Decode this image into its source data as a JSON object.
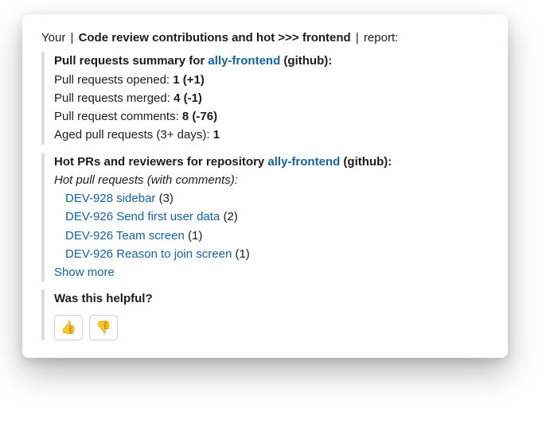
{
  "header": {
    "prefix": "Your",
    "sep": "|",
    "title": "Code review contributions and hot >>> frontend",
    "suffix": "report:"
  },
  "summary": {
    "heading_prefix": "Pull requests summary for ",
    "repo_link": "ally-frontend",
    "heading_suffix": " (github):",
    "opened_label": "Pull requests opened: ",
    "opened_value": "1 (+1)",
    "merged_label": "Pull requests merged: ",
    "merged_value": "4 (-1)",
    "comments_label": "Pull request comments: ",
    "comments_value": "8 (-76)",
    "aged_label": "Aged pull requests (3+ days): ",
    "aged_value": "1"
  },
  "hot": {
    "heading_prefix": "Hot PRs and reviewers for repository ",
    "repo_link": "ally-frontend",
    "heading_suffix": " (github):",
    "subheading": "Hot pull requests (with comments):",
    "items": [
      {
        "title": "DEV-928 sidebar",
        "count": "(3)"
      },
      {
        "title": "DEV-926 Send first user data",
        "count": "(2)"
      },
      {
        "title": "DEV-926 Team screen",
        "count": "(1)"
      },
      {
        "title": "DEV-926 Reason to join screen",
        "count": "(1)"
      }
    ],
    "show_more": "Show more"
  },
  "feedback": {
    "question": "Was this helpful?",
    "thumbs_up": "👍",
    "thumbs_down": "👎"
  }
}
